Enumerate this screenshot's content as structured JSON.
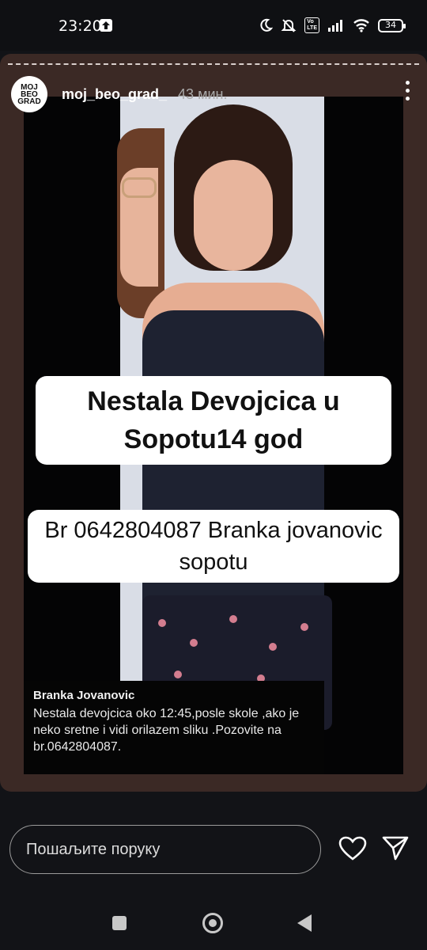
{
  "status_bar": {
    "time": "23:20",
    "network_label": "Vo\nLTE",
    "battery": "34"
  },
  "story": {
    "username": "moj_beo_grad_",
    "posted_ago": "43 мин.",
    "avatar_text": "MOJ\nBEO\nGRAD",
    "headline_1": "Nestala Devojcica u Sopotu14 god",
    "headline_2": "Br 0642804087 Branka jovanovic sopotu",
    "caption_name": "Branka Jovanovic",
    "caption_text": "Nestala devojcica oko 12:45,posle skole ,ako je neko sretne i vidi orilazem sliku .Pozovite na br.0642804087."
  },
  "footer": {
    "message_placeholder": "Пошаљите поруку"
  },
  "colors": {
    "background": "#121317",
    "story_frame": "#3b2925",
    "headline_bg": "#ffffff"
  },
  "icons": [
    "upload-icon",
    "moon-icon",
    "bell-off-icon",
    "signal-icon",
    "wifi-icon",
    "battery-icon",
    "more-vert-icon",
    "heart-icon",
    "send-icon",
    "nav-square-icon",
    "nav-home-icon",
    "nav-back-icon"
  ]
}
